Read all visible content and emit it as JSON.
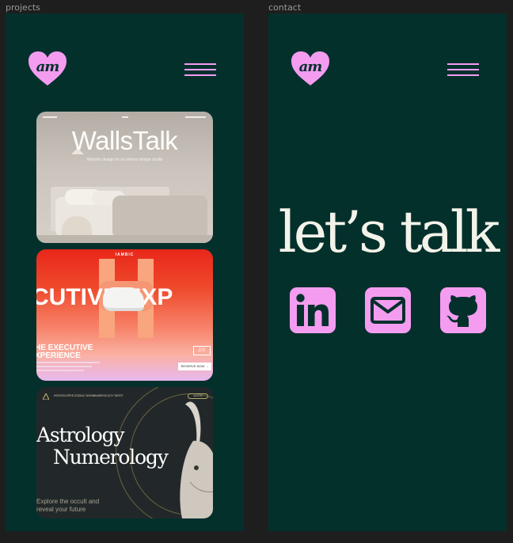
{
  "canvas": {
    "frames": [
      {
        "label": "projects"
      },
      {
        "label": "contact"
      }
    ]
  },
  "header": {
    "logo_text": "am",
    "menu_icon": "hamburger-icon"
  },
  "colors": {
    "background": "#04302c",
    "accent": "#f49cf0",
    "canvas": "#1e1e1e",
    "text_light": "#f3f3ea"
  },
  "projects": [
    {
      "id": "wallstalk",
      "title": "WallsTalk",
      "subtitle": "Website design for an interior design studio"
    },
    {
      "id": "iambic",
      "brand": "IAMBIC",
      "big_text": "CUTIVE EXP",
      "headline_line1": "HE EXECUTIVE",
      "headline_line2": "XPERIENCE",
      "cta": "RESERVE NOW →",
      "badge": "Z/X"
    },
    {
      "id": "astrology",
      "title_line1": "Astrology",
      "title_line2": "Numerology",
      "subtitle_line1": "Explore the occult and",
      "subtitle_line2": "reveal your future",
      "nav": [
        "HOROSCOPES",
        "ZODIAC SIGNS",
        "NUMEROLOGY",
        "TAROT"
      ],
      "nav_button": "SIGN IN"
    }
  ],
  "contact": {
    "heading": "let’s talk",
    "links": [
      {
        "icon": "linkedin-icon"
      },
      {
        "icon": "mail-icon"
      },
      {
        "icon": "github-icon"
      }
    ]
  }
}
